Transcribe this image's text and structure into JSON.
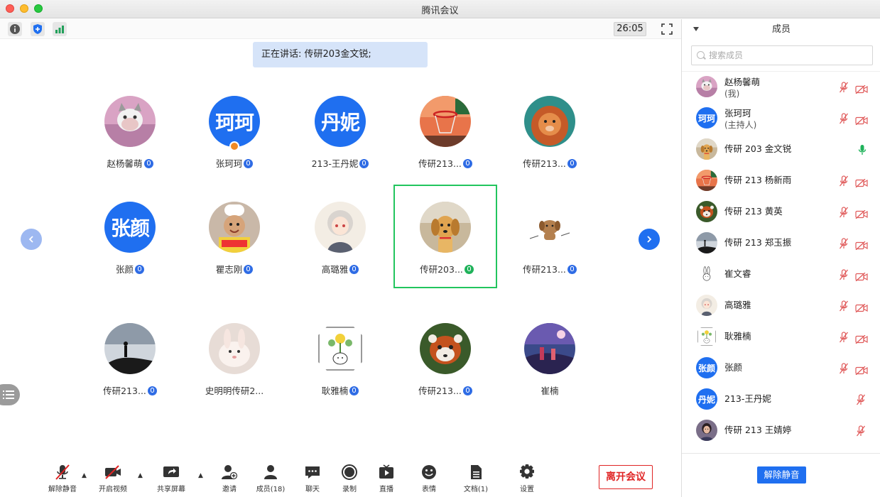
{
  "window": {
    "title": "腾讯会议"
  },
  "topbar": {
    "timer": "26:05"
  },
  "speaking": {
    "text": "正在讲话: 传研203金文锐;"
  },
  "grid": {
    "rows": [
      [
        {
          "name": "赵杨馨萌",
          "avatar": "photo-cat-pink",
          "mic": "blue"
        },
        {
          "name": "张珂珂",
          "avatar": "text",
          "avatar_text": "珂珂",
          "mic": "blue",
          "host": true
        },
        {
          "name": "213-王丹妮",
          "avatar": "text",
          "avatar_text": "丹妮",
          "mic": "blue"
        },
        {
          "name": "传研213...",
          "avatar": "photo-basketball",
          "mic": "blue"
        },
        {
          "name": "传研213...",
          "avatar": "photo-lion",
          "mic": "blue"
        }
      ],
      [
        {
          "name": "张颜",
          "avatar": "text",
          "avatar_text": "张颜",
          "mic": "blue"
        },
        {
          "name": "瞿志刚",
          "avatar": "photo-chef",
          "mic": "blue"
        },
        {
          "name": "高璐雅",
          "avatar": "photo-anime",
          "mic": "blue"
        },
        {
          "name": "传研203...",
          "avatar": "photo-dog",
          "mic": "green",
          "active": true
        },
        {
          "name": "传研213...",
          "avatar": "photo-puppy-drawing",
          "mic": "blue"
        }
      ],
      [
        {
          "name": "传研213...",
          "avatar": "photo-silhouette",
          "mic": "blue"
        },
        {
          "name": "史明明传研2...",
          "avatar": "photo-rabbit",
          "mic": null
        },
        {
          "name": "耿雅楠",
          "avatar": "photo-plant-drawing",
          "mic": "blue"
        },
        {
          "name": "传研213...",
          "avatar": "photo-red-panda",
          "mic": "blue"
        },
        {
          "name": "崔楠",
          "avatar": "photo-night-scene",
          "mic": null
        }
      ]
    ]
  },
  "toolbar": {
    "unmute": "解除静音",
    "video": "开启视频",
    "share": "共享屏幕",
    "invite": "邀请",
    "members": "成员(18)",
    "chat": "聊天",
    "record": "录制",
    "live": "直播",
    "reaction": "表情",
    "docs": "文档(1)",
    "settings": "设置",
    "leave": "离开会议"
  },
  "side": {
    "title": "成员",
    "search_placeholder": "搜索成员",
    "unmute_all": "解除静音",
    "members": [
      {
        "name": "赵杨馨萌",
        "role": "(我)",
        "avatar": "photo-cat-pink",
        "mic": "muted",
        "cam": "off"
      },
      {
        "name": "张珂珂",
        "role": "(主持人)",
        "avatar": "text",
        "avatar_text": "珂珂",
        "mic": "muted",
        "cam": "off"
      },
      {
        "name": "传研 203 金文锐",
        "avatar": "photo-dog",
        "mic": "active",
        "cam": "none"
      },
      {
        "name": "传研 213 杨新雨",
        "avatar": "photo-basketball",
        "mic": "muted",
        "cam": "off"
      },
      {
        "name": "传研 213 黄英",
        "avatar": "photo-red-panda",
        "mic": "muted",
        "cam": "off"
      },
      {
        "name": "传研 213 郑玉振",
        "avatar": "photo-silhouette",
        "mic": "muted",
        "cam": "off"
      },
      {
        "name": "崔文睿",
        "avatar": "photo-rabbit-drawing",
        "mic": "muted",
        "cam": "off"
      },
      {
        "name": "高璐雅",
        "avatar": "photo-anime",
        "mic": "muted",
        "cam": "off"
      },
      {
        "name": "耿雅楠",
        "avatar": "photo-plant-drawing",
        "mic": "muted",
        "cam": "off"
      },
      {
        "name": "张颜",
        "avatar": "text",
        "avatar_text": "张颜",
        "mic": "muted",
        "cam": "off"
      },
      {
        "name": "213-王丹妮",
        "avatar": "text",
        "avatar_text": "丹妮",
        "mic": "muted",
        "cam": "none"
      },
      {
        "name": "传研 213 王婧婷",
        "avatar": "photo-woman",
        "mic": "muted",
        "cam": "none"
      }
    ]
  },
  "colors": {
    "accent": "#1f6ff0",
    "active_border": "#22c55e",
    "leave": "#e02424",
    "muted": "#e05a5a"
  }
}
